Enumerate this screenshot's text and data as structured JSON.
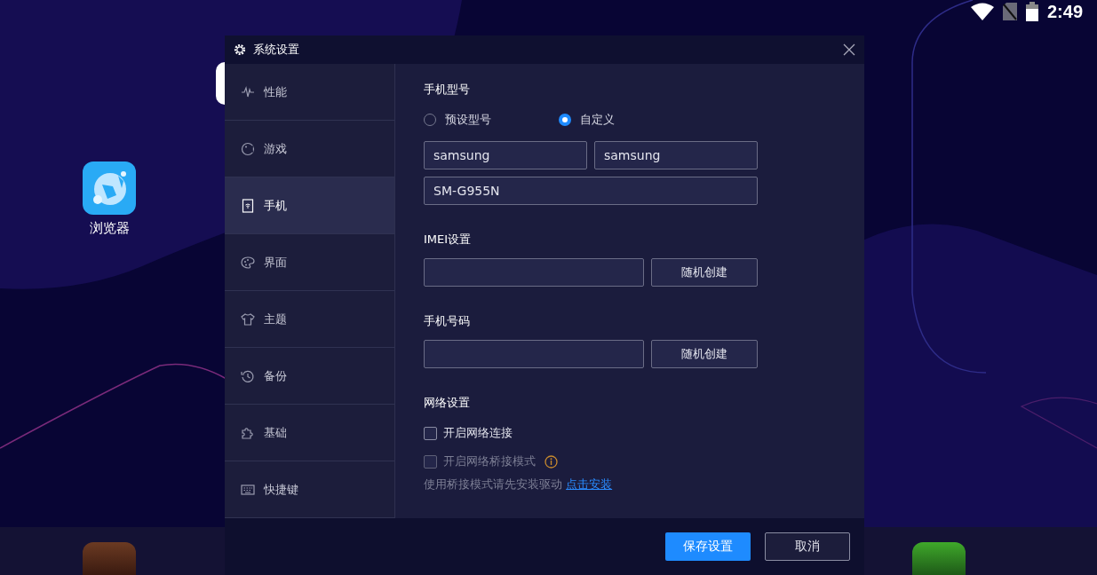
{
  "status_bar": {
    "time": "2:49"
  },
  "desktop": {
    "icons": [
      {
        "label": "浏览器"
      }
    ]
  },
  "dialog": {
    "title": "系统设置",
    "sidebar": {
      "items": [
        {
          "label": "性能",
          "selected": false
        },
        {
          "label": "游戏",
          "selected": false
        },
        {
          "label": "手机",
          "selected": true
        },
        {
          "label": "界面",
          "selected": false
        },
        {
          "label": "主题",
          "selected": false
        },
        {
          "label": "备份",
          "selected": false
        },
        {
          "label": "基础",
          "selected": false
        },
        {
          "label": "快捷键",
          "selected": false
        }
      ]
    },
    "model": {
      "title": "手机型号",
      "options": [
        {
          "label": "预设型号",
          "selected": false
        },
        {
          "label": "自定义",
          "selected": true
        }
      ],
      "fields": [
        {
          "value": "samsung"
        },
        {
          "value": "samsung"
        },
        {
          "value": "SM-G955N"
        }
      ]
    },
    "imei": {
      "title": "IMEI设置",
      "button": "随机创建"
    },
    "phone_number": {
      "title": "手机号码",
      "button": "随机创建"
    },
    "network": {
      "title": "网络设置",
      "options": [
        {
          "label": "开启网络连接",
          "checked": false,
          "disabled": false
        },
        {
          "label": "开启网络桥接模式",
          "checked": false,
          "disabled": true
        }
      ],
      "note": "使用桥接模式请先安装驱动",
      "link": "点击安装"
    },
    "buttons": {
      "save": "保存设置",
      "cancel": "取消"
    }
  }
}
